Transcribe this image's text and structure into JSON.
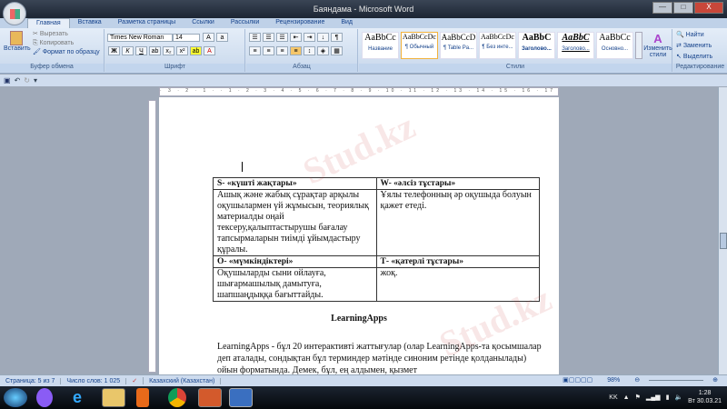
{
  "window": {
    "title": "Баяндама - Microsoft Word",
    "minimize": "—",
    "maximize": "□",
    "close": "X"
  },
  "tabs": [
    "Главная",
    "Вставка",
    "Разметка страницы",
    "Ссылки",
    "Рассылки",
    "Рецензирование",
    "Вид"
  ],
  "clipboard": {
    "paste": "Вставить",
    "cut": "Вырезать",
    "copy": "Копировать",
    "format_painter": "Формат по образцу",
    "label": "Буфер обмена"
  },
  "font": {
    "name": "Times New Roman",
    "size": "14",
    "label": "Шрифт",
    "bold": "Ж",
    "italic": "К",
    "underline": "Ч"
  },
  "paragraph": {
    "label": "Абзац"
  },
  "styles": {
    "label": "Стили",
    "items": [
      {
        "preview": "AaBbCc",
        "name": "Название"
      },
      {
        "preview": "AaBbCcDc",
        "name": "¶ Обычный"
      },
      {
        "preview": "AaBbCcD",
        "name": "¶ Table Pa..."
      },
      {
        "preview": "AaBbCcDc",
        "name": "¶ Без инте..."
      },
      {
        "preview": "AaBbC",
        "name": "Заголово..."
      },
      {
        "preview": "AaBbC",
        "name": "Заголово..."
      },
      {
        "preview": "AaBbCc",
        "name": "Основно..."
      }
    ],
    "change": "Изменить стили"
  },
  "editing": {
    "find": "Найти",
    "replace": "Заменить",
    "select": "Выделить",
    "label": "Редактирование"
  },
  "ruler": "· 3 · 2 · 1 · · 1 · 2 · 3 · 4 · 5 · 6 · 7 · 8 · 9 · 10 · 11 · 12 · 13 · 14 · 15 · 16 · 17 ·",
  "document": {
    "table": [
      [
        "S- «күшті жақтары»",
        "W-  «әлсіз тұстары»"
      ],
      [
        "Ашық және жабық сұрақтар арқылы оқушылармен үй жұмысын, теориялық материалды оңай тексеру,қалыптастырушы бағалау тапсырмаларын тиімді ұйымдастыру құралы.",
        "Ұялы телефонның әр оқушыда болуын қажет етеді."
      ],
      [
        "О- «мүмкіндіктері»",
        "Т- «қатерлі тұстары»"
      ],
      [
        "Оқушыларды сыни ойлауға, шығармашылық дамытуға, шапшаңдыққа бағыттайды.",
        "жоқ."
      ]
    ],
    "heading": "LearningApps",
    "paragraph": "LearningApps - бұл 20 интерактивті жаттығулар  (олар LearningApps-та қосымшалар деп аталады, сондықтан бұл терминдер мәтінде синоним ретінде қолданылады) ойын форматында. Демек, бұл, ең алдымен,  қызмет"
  },
  "status": {
    "page": "Страница: 5 из 7",
    "words": "Число слов: 1 025",
    "language": "Казахский (Казахстан)",
    "zoom": "98%"
  },
  "tray": {
    "lang": "KK",
    "time": "1:28",
    "date": "Вт 30.03.21"
  },
  "watermark": "Stud.kz"
}
